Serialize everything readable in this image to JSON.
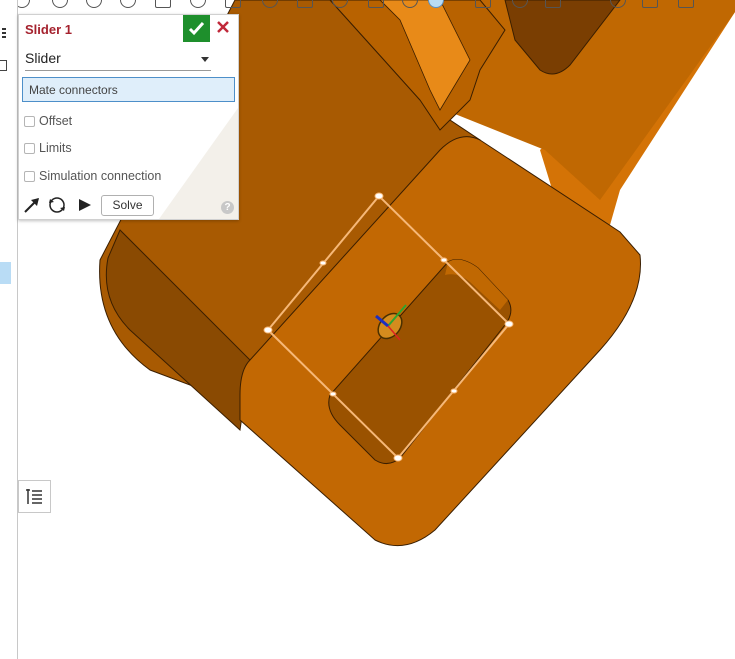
{
  "dialog": {
    "title": "Slider 1",
    "type_selected": "Slider",
    "mate_connectors_placeholder": "Mate connectors",
    "options": [
      {
        "label": "Offset",
        "checked": false
      },
      {
        "label": "Limits",
        "checked": false
      },
      {
        "label": "Simulation connection",
        "checked": false
      }
    ],
    "solve_label": "Solve",
    "help_glyph": "?"
  },
  "icons": {
    "accept": "check-icon",
    "cancel": "close-icon",
    "arrow_tool": "arrow-pointer-icon",
    "rotate_tool": "rotate-icon",
    "play": "play-icon",
    "help": "help-icon",
    "list": "list-icon"
  },
  "colors": {
    "title": "#a5222e",
    "accept_bg": "#1e8f2c",
    "cancel": "#c0283a",
    "part_face": "#b86200",
    "part_top": "#d47306",
    "part_dark": "#8a4a02",
    "selection_box": "#f6b878",
    "field_bg": "#dfeefa",
    "field_border": "#4d8fc9"
  }
}
